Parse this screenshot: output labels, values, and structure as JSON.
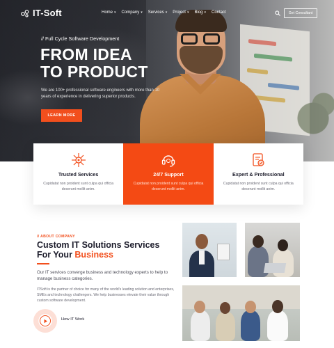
{
  "brand": {
    "name": "IT-Soft",
    "accent": "#f24f1d"
  },
  "nav": {
    "items": [
      {
        "label": "Home",
        "caret": true
      },
      {
        "label": "Company",
        "caret": true
      },
      {
        "label": "Services",
        "caret": true
      },
      {
        "label": "Project",
        "caret": true
      },
      {
        "label": "Blog",
        "caret": true
      },
      {
        "label": "Contact",
        "caret": false
      }
    ],
    "cta": "Get Consultant",
    "search_icon": "search-icon"
  },
  "hero": {
    "eyebrow": "// Full Cycle Software Development",
    "title_line1": "FROM IDEA",
    "title_line2": "TO PRODUCT",
    "description": "We are 100+ professional software engineers with more than 10 years of experience in delivering superior products.",
    "button": "LEARN MORE"
  },
  "features": [
    {
      "icon": "network-icon",
      "title": "Trusted Services",
      "text": "Cupidatat non proident sunt culpa qui officia deserunt mollit anim.",
      "active": false
    },
    {
      "icon": "support-headset-icon",
      "title": "24/7 Support",
      "text": "Cupidatat non proident sunt culpa qui officia deserunt mollit anim.",
      "active": true
    },
    {
      "icon": "expert-badge-icon",
      "title": "Expert & Professional",
      "text": "Cupidatat non proident sunt culpa qui officia deserunt mollit anim.",
      "active": false
    }
  ],
  "about": {
    "eyebrow": "// ABOUT COMPANY",
    "title_line1": "Custom IT Solutions Services",
    "title_line2_prefix": "For Your ",
    "title_line2_highlight": "Business",
    "lead": "Our IT services converge business and technology experts to help to manage business categories.",
    "body": "ITSoft is the partner of choice for many of the world's leading solution and enterprises, SMEs and technology challengers. We help businesses elevate their value through custom software development.",
    "play_label": "How IT Work"
  }
}
